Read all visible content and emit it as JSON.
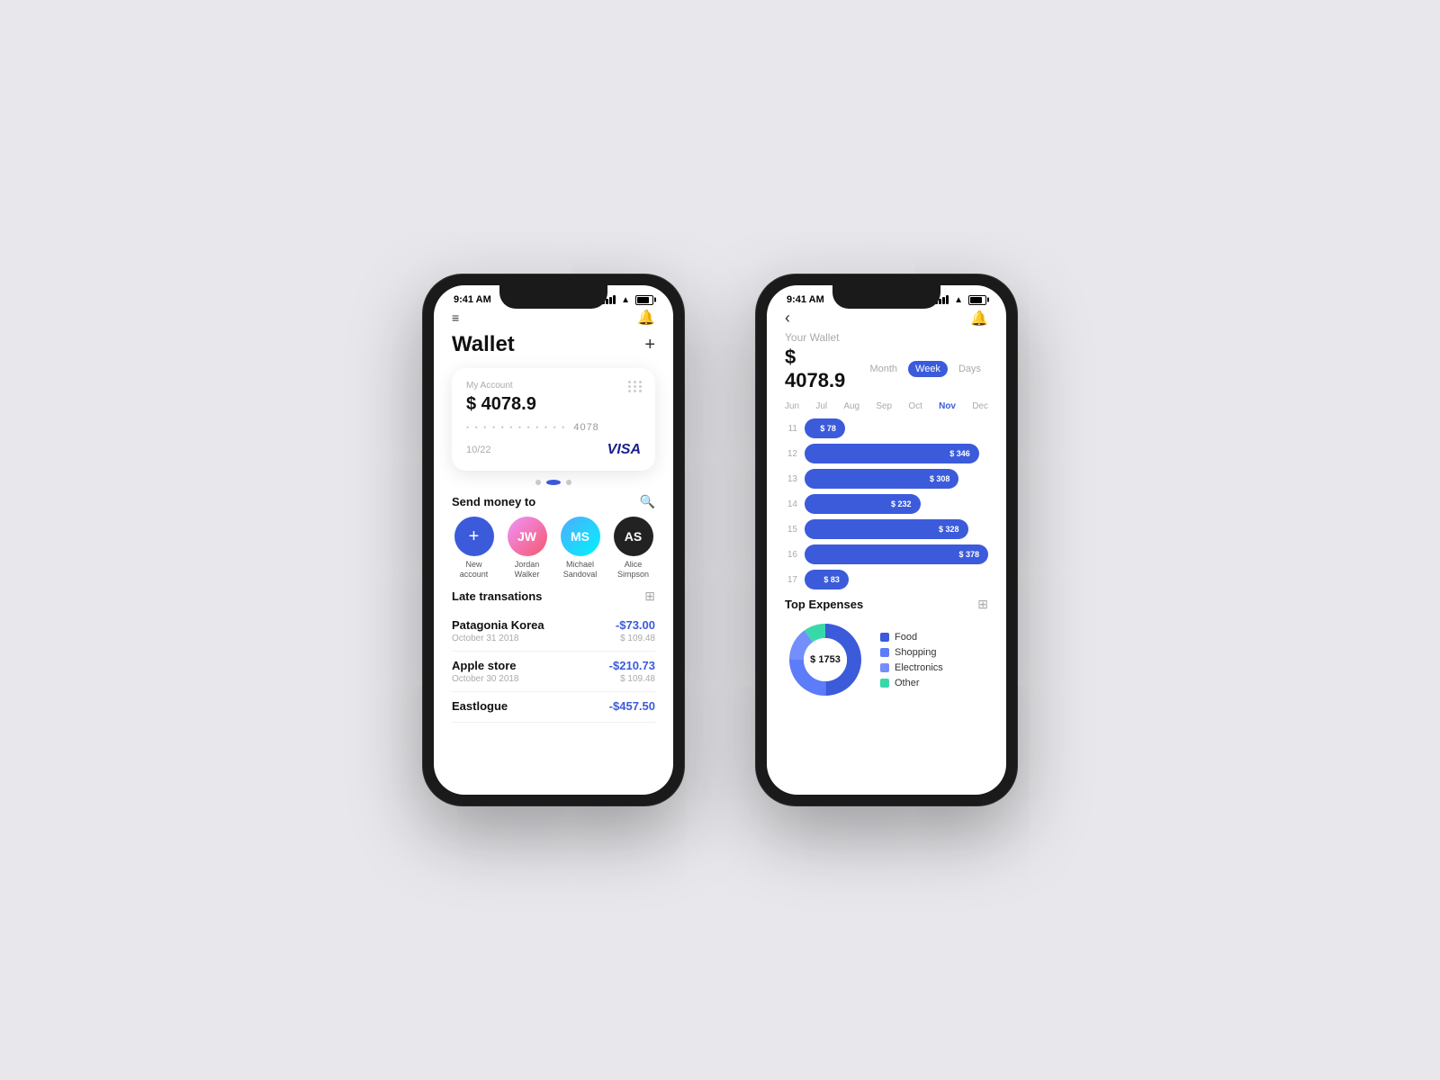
{
  "background_color": "#e8e8ec",
  "phone1": {
    "status_time": "9:41 AM",
    "header": {
      "menu_label": "☰",
      "bell_label": "🔔"
    },
    "title": "Wallet",
    "add_label": "+",
    "card": {
      "label": "My Account",
      "amount": "$ 4078.9",
      "number_dots": "• • • • • • • • • • • •",
      "number_last4": "4078",
      "expiry": "10/22",
      "visa": "VISA"
    },
    "pagination": [
      "",
      "",
      ""
    ],
    "send_money": {
      "title": "Send money to",
      "contacts": [
        {
          "name": "New\naccount",
          "type": "new"
        },
        {
          "name": "Jordan\nWalker",
          "type": "jordan",
          "initials": "JW"
        },
        {
          "name": "Michael\nSandoval",
          "type": "michael",
          "initials": "MS"
        },
        {
          "name": "Alice\nSimpson",
          "type": "alice",
          "initials": "AS"
        }
      ]
    },
    "transactions": {
      "title": "Late transations",
      "items": [
        {
          "name": "Patagonia Korea",
          "date": "October 31 2018",
          "amount": "-$73.00",
          "balance": "$ 109.48"
        },
        {
          "name": "Apple store",
          "date": "October 30 2018",
          "amount": "-$210.73",
          "balance": "$ 109.48"
        },
        {
          "name": "Eastlogue",
          "date": "",
          "amount": "-$457.50",
          "balance": ""
        }
      ]
    }
  },
  "phone2": {
    "status_time": "9:41 AM",
    "header": {
      "back_label": "‹",
      "bell_label": "🔔"
    },
    "wallet_label": "Your Wallet",
    "amount": "$ 4078.9",
    "period_tabs": [
      "Month",
      "Week",
      "Days"
    ],
    "active_period": "Week",
    "months": [
      "Jun",
      "Jul",
      "Aug",
      "Sep",
      "Oct",
      "Nov",
      "Dec"
    ],
    "active_month": "Nov",
    "bars": [
      {
        "day": "11",
        "value": 78,
        "label": "$ 78",
        "width_pct": 22
      },
      {
        "day": "12",
        "value": 346,
        "label": "$ 346",
        "width_pct": 95
      },
      {
        "day": "13",
        "value": 308,
        "label": "$ 308",
        "width_pct": 84
      },
      {
        "day": "14",
        "value": 232,
        "label": "$ 232",
        "width_pct": 63
      },
      {
        "day": "15",
        "value": 328,
        "label": "$ 328",
        "width_pct": 89
      },
      {
        "day": "16",
        "value": 378,
        "label": "$ 378",
        "width_pct": 100
      },
      {
        "day": "17",
        "value": 83,
        "label": "$ 83",
        "width_pct": 24
      }
    ],
    "top_expenses": {
      "title": "Top Expenses",
      "total": "$ 1753",
      "legend": [
        {
          "label": "Food",
          "color": "#3b5bdb"
        },
        {
          "label": "Shopping",
          "color": "#5c7cfa"
        },
        {
          "label": "Electronics",
          "color": "#748ffc"
        },
        {
          "label": "Other",
          "color": "#38d9a9"
        }
      ]
    }
  }
}
